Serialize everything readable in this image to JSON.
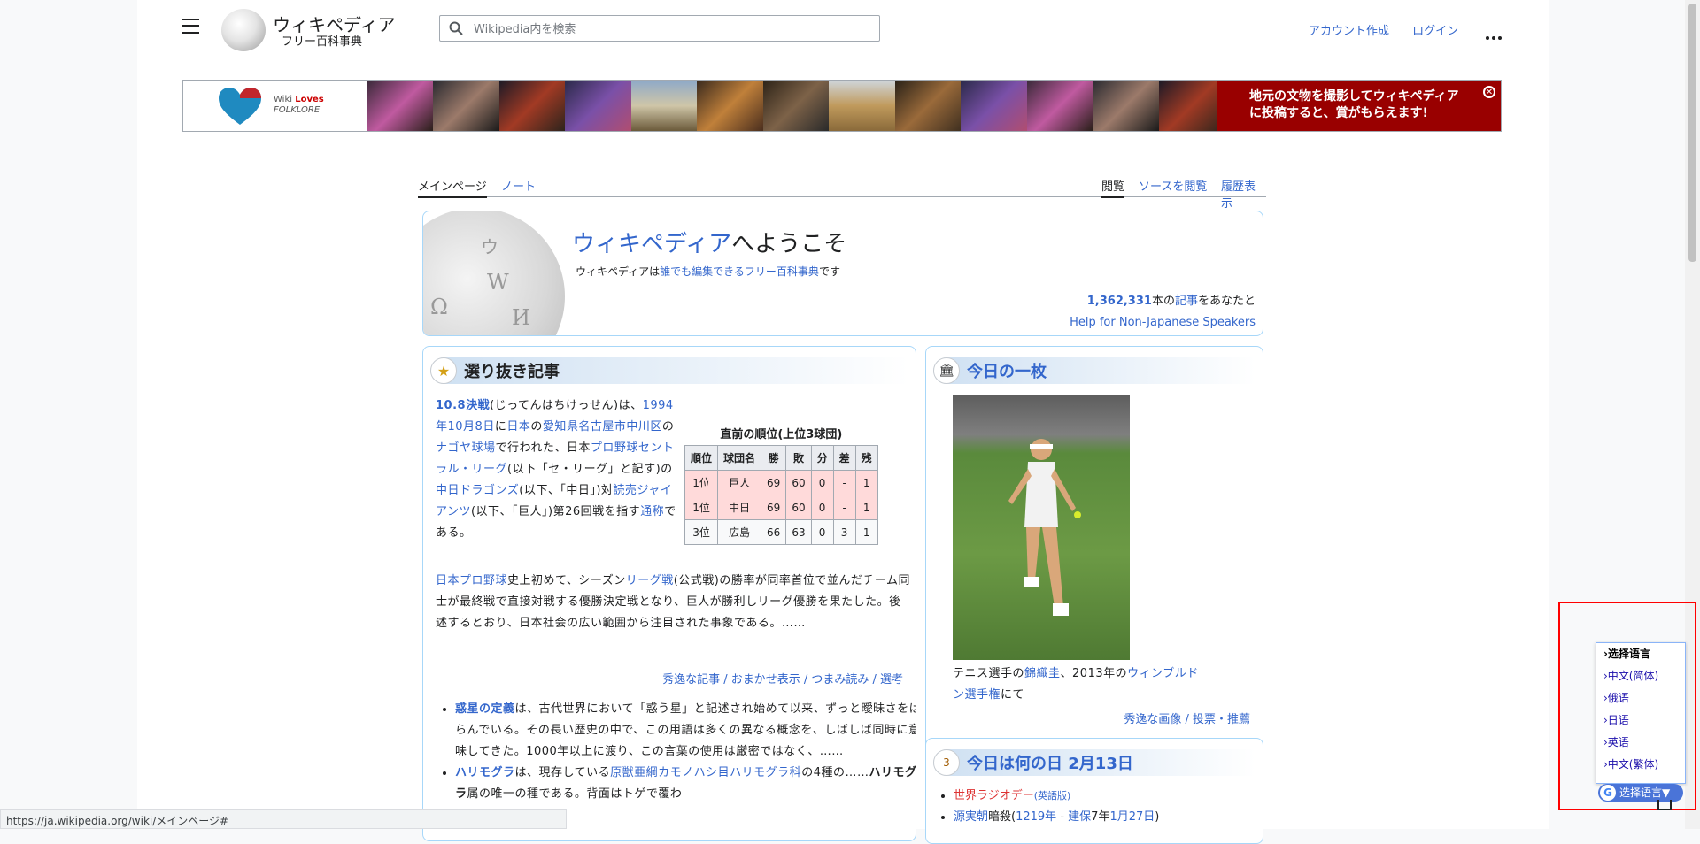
{
  "header": {
    "logo_title": "ウィキペディア",
    "logo_sub": "フリー百科事典",
    "search_placeholder": "Wikipedia内を検索",
    "create_account": "アカウント作成",
    "login": "ログイン"
  },
  "banner": {
    "logo_line1_a": "Wiki ",
    "logo_line1_b": "Loves",
    "logo_line2": "FOLKLORE",
    "message_line1": "地元の文物を撮影してウィキペディア",
    "message_line2": "に投稿すると、賞がもらえます!"
  },
  "tabs": {
    "main": "メインページ",
    "talk": "ノート",
    "read": "閲覧",
    "view_source": "ソースを閲覧",
    "history": "履歴表示"
  },
  "welcome": {
    "title_link": "ウィキペディア",
    "title_rest": "へようこそ",
    "sub_1": "ウィキペディアは",
    "sub_link": "誰でも編集できるフリー百科事典",
    "sub_2": "です",
    "count_num": "1,362,331",
    "count_mid": "本の",
    "count_link": "記事",
    "count_end": "をあなたと",
    "help": "Help for Non-Japanese Speakers"
  },
  "featured": {
    "title": "選り抜き記事",
    "p1": [
      {
        "t": "10.8決戦",
        "link": true,
        "bold": true
      },
      {
        "t": "(じってんはちけっせん)は、"
      },
      {
        "t": "1994年",
        "link": true
      },
      {
        "t": "10月8日",
        "link": true
      },
      {
        "t": "に"
      },
      {
        "t": "日本",
        "link": true
      },
      {
        "t": "の"
      },
      {
        "t": "愛知県",
        "link": true
      },
      {
        "t": "名古屋市中川区",
        "link": true
      },
      {
        "t": "の"
      },
      {
        "t": "ナゴヤ球場",
        "link": true
      },
      {
        "t": "で行われた、日本"
      },
      {
        "t": "プロ野球",
        "link": true
      },
      {
        "t": "セントラル・リーグ",
        "link": true
      },
      {
        "t": "(以下「セ・リーグ」と記す)の"
      },
      {
        "t": "中日ドラゴンズ",
        "link": true
      },
      {
        "t": "(以下、「中日」)対"
      },
      {
        "t": "読売ジャイアンツ",
        "link": true
      },
      {
        "t": "(以下、「巨人」)第26回戦を指す"
      },
      {
        "t": "通称",
        "link": true
      },
      {
        "t": "である。"
      }
    ],
    "p2": [
      {
        "t": "日本プロ野球",
        "link": true
      },
      {
        "t": "史上初めて、シーズン"
      },
      {
        "t": "リーグ戦",
        "link": true
      },
      {
        "t": "(公式戦)の勝率が同率首位で並んだチーム同士が最終戦で直接対戦する優勝決定戦となり、巨人が勝利しリーグ優勝を果たした。後述するとおり、日本社会の広い範囲から注目された事象である。……"
      }
    ],
    "more": "秀逸な記事 / おまかせ表示 / つまみ読み / 選考",
    "table": {
      "caption": "直前の順位(上位3球団)",
      "headers": [
        "順位",
        "球団名",
        "勝",
        "敗",
        "分",
        "差",
        "残"
      ],
      "rows": [
        [
          "1位",
          "巨人",
          "69",
          "60",
          "0",
          "-",
          "1"
        ],
        [
          "1位",
          "中日",
          "69",
          "60",
          "0",
          "-",
          "1"
        ],
        [
          "3位",
          "広島",
          "66",
          "63",
          "0",
          "3",
          "1"
        ]
      ]
    },
    "bullets": [
      [
        {
          "t": "惑星の定義",
          "link": true,
          "bold": true
        },
        {
          "t": "は、古代世界において「惑う星」と記述され始めて以来、ずっと曖昧さをはらんでいる。その長い歴史の中で、この用語は多くの異なる概念を、しばしば同時に意味してきた。1000年以上に渡り、この言葉の使用は厳密ではなく、……"
        }
      ],
      [
        {
          "t": "ハリモグラ",
          "link": true,
          "bold": true
        },
        {
          "t": "は、現存している"
        },
        {
          "t": "原獣亜綱",
          "link": true
        },
        {
          "t": "カモノハシ目",
          "link": true
        },
        {
          "t": "ハリモグラ科",
          "link": true
        },
        {
          "t": "の4種の……"
        },
        {
          "t": "ハリモグラ",
          "bold": true
        },
        {
          "t": "属の唯一の種である。背面はトゲで覆わ"
        }
      ]
    ]
  },
  "picture": {
    "title": "今日の一枚",
    "caption": [
      {
        "t": "テニス選手の"
      },
      {
        "t": "錦織圭",
        "link": true
      },
      {
        "t": "、2013年の"
      },
      {
        "t": "ウィンブルドン選手権",
        "link": true
      },
      {
        "t": "にて"
      }
    ],
    "more": "秀逸な画像 / 投票・推薦"
  },
  "today": {
    "title": "今日は何の日 2月13日",
    "items": [
      [
        {
          "t": "世界ラジオデー",
          "red": true
        },
        {
          "t": "(英語版)",
          "small": true,
          "link": true
        }
      ],
      [
        {
          "t": "源実朝",
          "link": true
        },
        {
          "t": "暗殺("
        },
        {
          "t": "1219年",
          "link": true
        },
        {
          "t": " - "
        },
        {
          "t": "建保",
          "link": true
        },
        {
          "t": "7年"
        },
        {
          "t": "1月27日",
          "link": true
        },
        {
          "t": ")"
        }
      ]
    ]
  },
  "status_url": "https://ja.wikipedia.org/wiki/メインページ#",
  "lang_popup": {
    "header": "›选择语言",
    "items": [
      "›中文(简体)",
      "›俄语",
      "›日语",
      "›英语",
      "›中文(繁体)"
    ],
    "button": "选择语言▼"
  },
  "colors": {
    "link": "#3366cc",
    "banner_red": "#990000",
    "frame": "#ff0000"
  }
}
